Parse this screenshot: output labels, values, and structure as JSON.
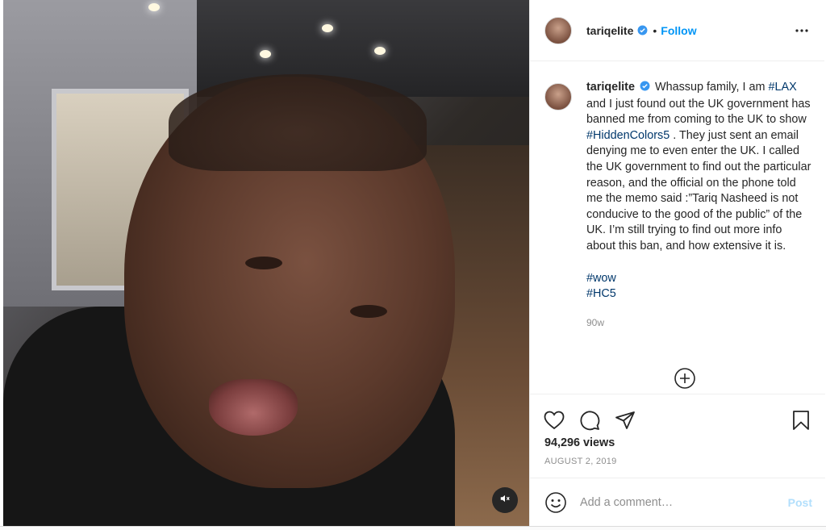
{
  "post": {
    "username": "tariqelite",
    "follow_label": "Follow",
    "dot": "•",
    "caption_parts": {
      "p1": "Whassup family, I am ",
      "tag1": "#LAX",
      "p2": " and I just found out the UK government has banned me from coming to the UK to show ",
      "tag2": "#HiddenColors5",
      "p3": " . They just sent an email denying me to even enter the UK. I called the UK government to find out the particular reason, and the official on the phone told me the memo said :”Tariq Nasheed is not conducive to the good of the public” of the UK. I’m still trying to find out more info about this ban, and how extensive it is."
    },
    "hashtags": [
      "#wow",
      "#HC5"
    ],
    "time_ago": "90w",
    "views": "94,296 views",
    "date": "AUGUST 2, 2019",
    "comment_placeholder": "Add a comment…",
    "post_label": "Post"
  },
  "colors": {
    "accent": "#0095f6",
    "hashtag": "#00376b",
    "muted": "#8e8e8e",
    "post_disabled": "#b2dffc"
  },
  "icons": [
    "verified-badge-icon",
    "more-options-icon",
    "load-more-comments-icon",
    "heart-icon",
    "comment-icon",
    "share-icon",
    "bookmark-icon",
    "emoji-icon",
    "mute-icon"
  ]
}
